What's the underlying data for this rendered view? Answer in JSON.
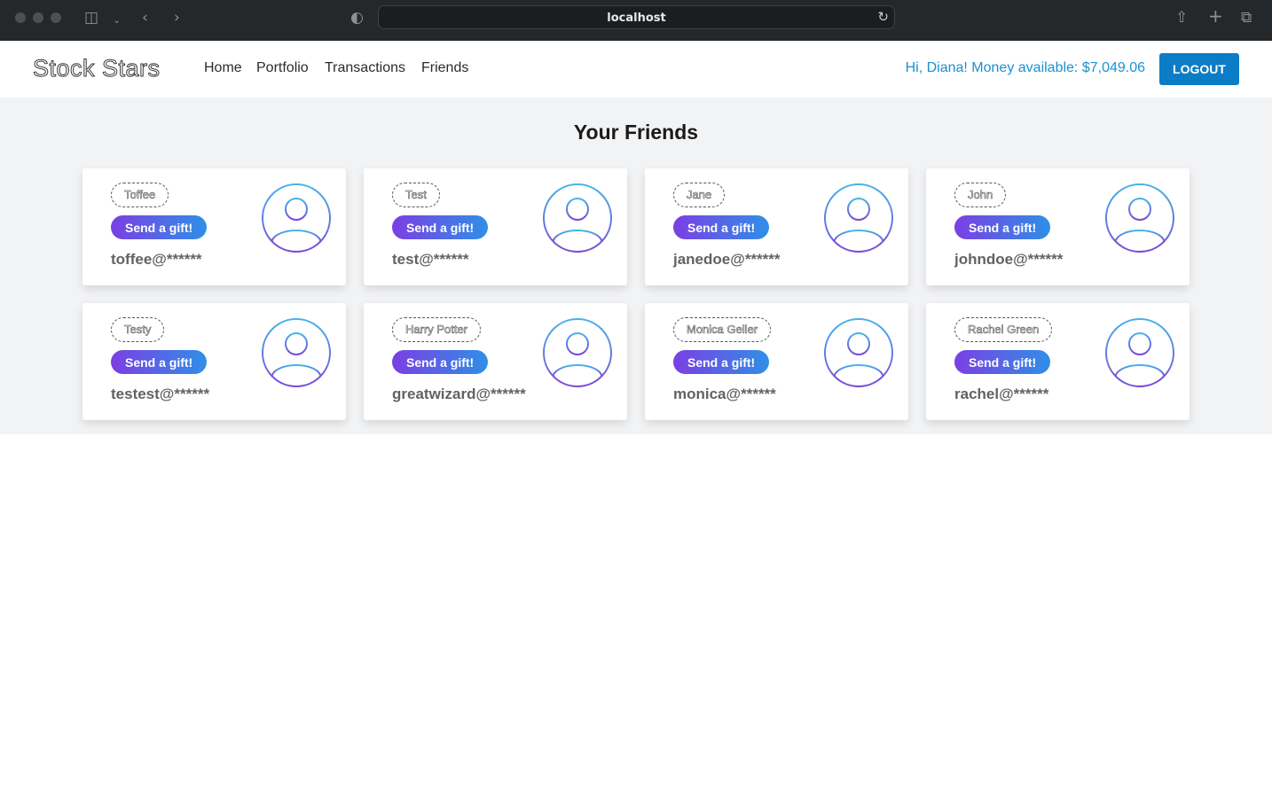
{
  "browser": {
    "url": "localhost"
  },
  "navbar": {
    "brand": "Stock Stars",
    "links": [
      "Home",
      "Portfolio",
      "Transactions",
      "Friends"
    ],
    "money": "Hi, Diana! Money available: $7,049.06",
    "logout_label": "LOGOUT"
  },
  "page": {
    "title": "Your Friends"
  },
  "friends": [
    {
      "name": "Toffee",
      "gift_label": "Send a gift!",
      "email": "toffee@******"
    },
    {
      "name": "Test",
      "gift_label": "Send a gift!",
      "email": "test@******"
    },
    {
      "name": "Jane",
      "gift_label": "Send a gift!",
      "email": "janedoe@******"
    },
    {
      "name": "John",
      "gift_label": "Send a gift!",
      "email": "johndoe@******"
    },
    {
      "name": "Testy",
      "gift_label": "Send a gift!",
      "email": "testest@******"
    },
    {
      "name": "Harry Potter",
      "gift_label": "Send a gift!",
      "email": "greatwizard@******"
    },
    {
      "name": "Monica Geller",
      "gift_label": "Send a gift!",
      "email": "monica@******"
    },
    {
      "name": "Rachel Green",
      "gift_label": "Send a gift!",
      "email": "rachel@******"
    }
  ],
  "colors": {
    "accent": "#0b7cc6",
    "money_text": "#1a91d2",
    "gift_gradient_start": "#7b3fe4",
    "gift_gradient_end": "#2f8fe6"
  },
  "icons": {
    "avatar": "user-avatar-icon"
  }
}
